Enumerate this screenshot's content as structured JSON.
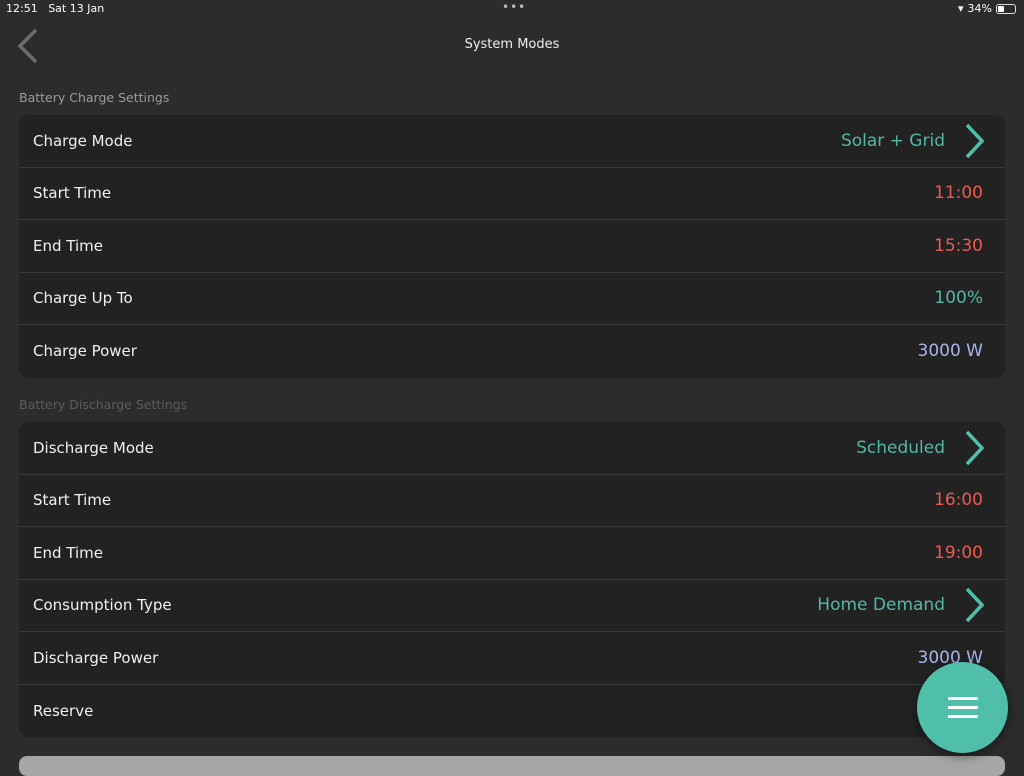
{
  "status_bar": {
    "time": "12:51",
    "date": "Sat 13 Jan",
    "battery": "34%",
    "battery_level": 0.34
  },
  "header": {
    "title": "System Modes"
  },
  "colors": {
    "teal": "#52b8a4",
    "red": "#ec5a4f",
    "lavender": "#aab4ec"
  },
  "charge": {
    "section_title": "Battery Charge Settings",
    "rows": [
      {
        "label": "Charge Mode",
        "value": "Solar + Grid",
        "color": "teal",
        "chevron": true
      },
      {
        "label": "Start Time",
        "value": "11:00",
        "color": "red"
      },
      {
        "label": "End Time",
        "value": "15:30",
        "color": "red"
      },
      {
        "label": "Charge Up To",
        "value": "100%",
        "color": "teal"
      },
      {
        "label": "Charge Power",
        "value": "3000 W",
        "color": "lavender"
      }
    ]
  },
  "discharge": {
    "section_title": "Battery Discharge Settings",
    "rows": [
      {
        "label": "Discharge Mode",
        "value": "Scheduled",
        "color": "teal",
        "chevron": true
      },
      {
        "label": "Start Time",
        "value": "16:00",
        "color": "red"
      },
      {
        "label": "End Time",
        "value": "19:00",
        "color": "red"
      },
      {
        "label": "Consumption Type",
        "value": "Home Demand",
        "color": "teal",
        "chevron": true
      },
      {
        "label": "Discharge Power",
        "value": "3000 W",
        "color": "lavender"
      },
      {
        "label": "Reserve",
        "value": ""
      }
    ]
  }
}
